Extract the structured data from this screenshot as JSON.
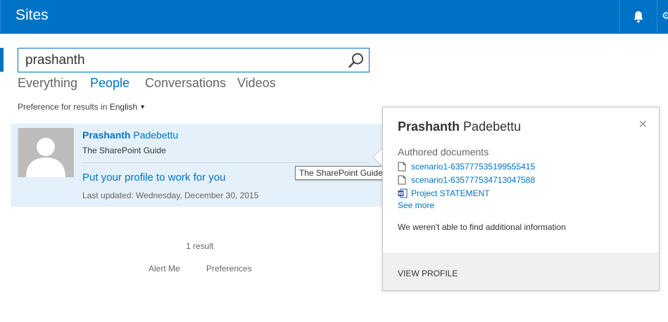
{
  "suite_bar": {
    "title": "Sites",
    "bell_icon": "bell-icon"
  },
  "search": {
    "value": "prashanth",
    "icon": "search-icon"
  },
  "verticals": [
    {
      "label": "Everything",
      "active": false
    },
    {
      "label": "People",
      "active": true
    },
    {
      "label": "Conversations",
      "active": false
    },
    {
      "label": "Videos",
      "active": false
    }
  ],
  "preference": {
    "label": "Preference for results in",
    "language": "English"
  },
  "result": {
    "first_name": "Prashanth",
    "last_name": "Padebettu",
    "org": "The SharePoint Guide",
    "profile_link": "Put your profile to work for you",
    "last_updated": "Last updated: Wednesday, December 30, 2015",
    "tooltip": "The SharePoint Guide"
  },
  "footer": {
    "count": "1 result",
    "alert_me": "Alert Me",
    "preferences": "Preferences"
  },
  "hover_card": {
    "first_name": "Prashanth",
    "last_name": "Padebettu",
    "section_title": "Authored documents",
    "documents": [
      {
        "name": "scenario1-635777535199555415",
        "icon": "document-icon"
      },
      {
        "name": "scenario1-635777534713047588",
        "icon": "document-icon"
      },
      {
        "name": "Project STATEMENT",
        "icon": "word-document-icon"
      }
    ],
    "see_more": "See more",
    "info": "We weren't able to find additional information",
    "view_profile": "VIEW PROFILE"
  },
  "colors": {
    "accent": "#0072c6",
    "result_bg": "#e5f1fa",
    "card_footer": "#f0f0f0"
  }
}
